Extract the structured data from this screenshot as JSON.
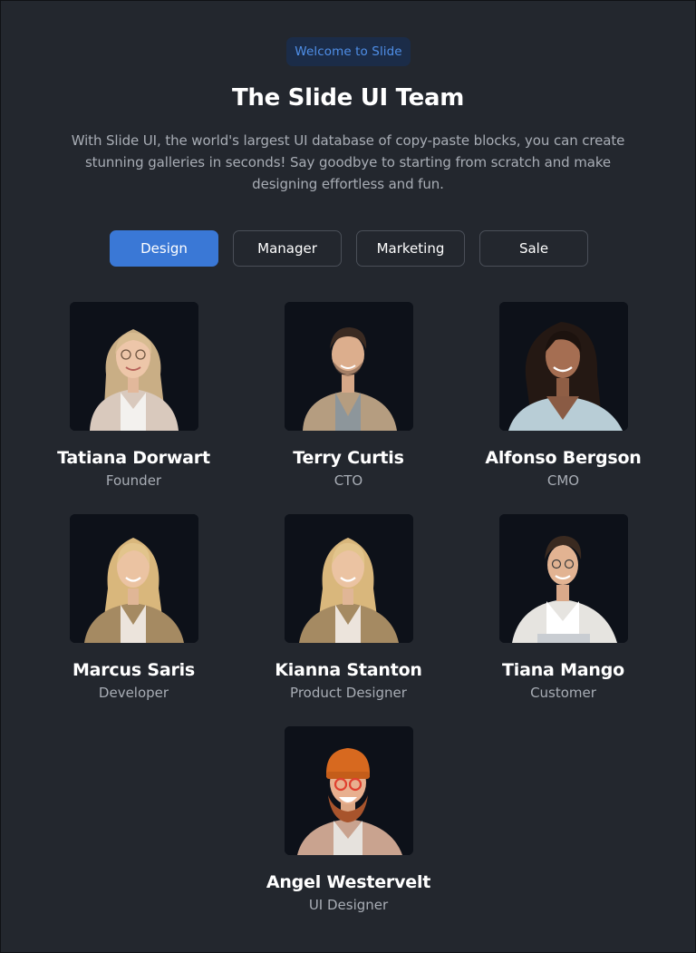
{
  "header": {
    "badge": "Welcome to Slide",
    "title": "The Slide UI Team",
    "description": "With Slide UI, the world's largest UI database of copy-paste blocks, you can create stunning galleries in seconds! Say goodbye to starting from scratch and make designing effortless and fun."
  },
  "tabs": [
    {
      "label": "Design",
      "active": true
    },
    {
      "label": "Manager",
      "active": false
    },
    {
      "label": "Marketing",
      "active": false
    },
    {
      "label": "Sale",
      "active": false
    }
  ],
  "members": [
    {
      "name": "Tatiana Dorwart",
      "role": "Founder"
    },
    {
      "name": "Terry Curtis",
      "role": "CTO"
    },
    {
      "name": "Alfonso Bergson",
      "role": "CMO"
    },
    {
      "name": "Marcus Saris",
      "role": "Developer"
    },
    {
      "name": "Kianna Stanton",
      "role": "Product Designer"
    },
    {
      "name": "Tiana Mango",
      "role": "Customer"
    },
    {
      "name": "Angel Westervelt",
      "role": "UI Designer"
    }
  ],
  "colors": {
    "background": "#23272e",
    "accent": "#3a78d6",
    "badge_text": "#4f8fe8",
    "muted_text": "#a8adb5"
  }
}
